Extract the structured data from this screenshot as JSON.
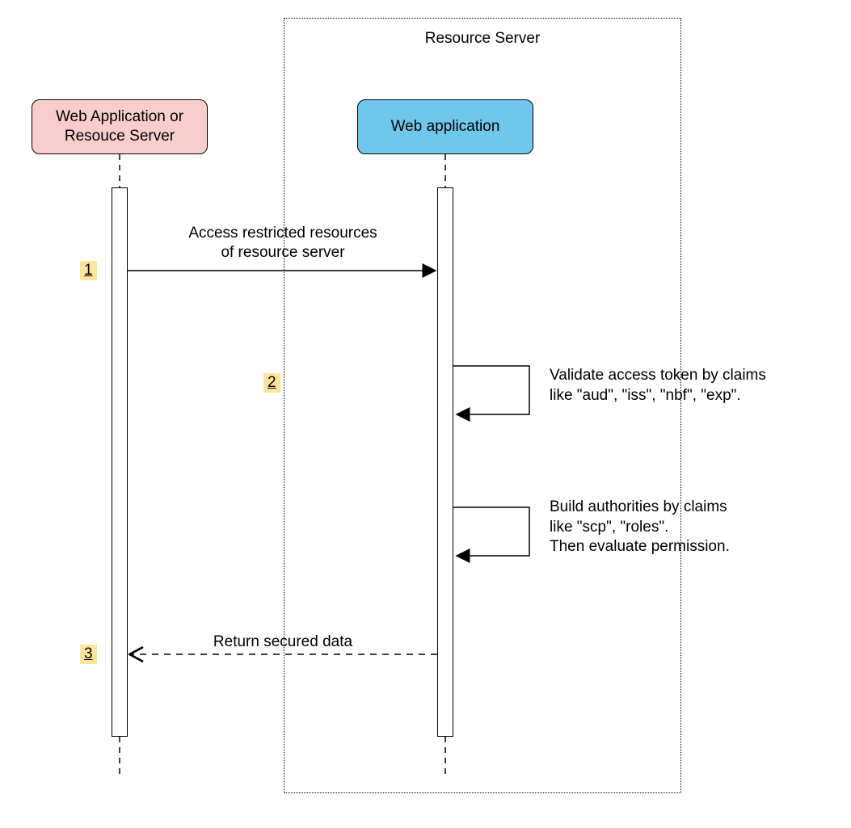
{
  "diagram": {
    "type": "sequence",
    "frameTitle": "Resource Server",
    "participants": {
      "left": {
        "title": "Web Application or\nResouce Server",
        "color": "#f8cecc"
      },
      "right": {
        "title": "Web application",
        "color": "#6fc8ec"
      }
    },
    "steps": {
      "s1": "1",
      "s2": "2",
      "s3": "3"
    },
    "messages": {
      "m1": "Access restricted resources\nof resource server",
      "m3": "Return secured data"
    },
    "notes": {
      "n2a": "Validate access token by claims\nlike \"aud\", \"iss\", \"nbf\", \"exp\".",
      "n2b": "Build authorities by claims\nlike \"scp\", \"roles\".\nThen evaluate permission."
    }
  }
}
